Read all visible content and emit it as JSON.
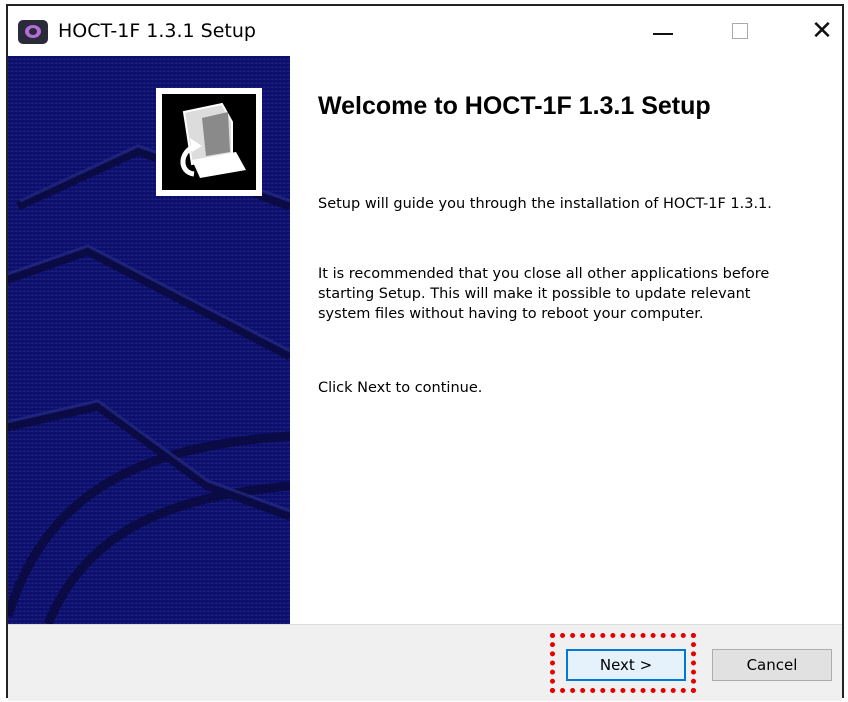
{
  "window": {
    "title": "HOCT-1F 1.3.1 Setup",
    "icon": "app-eye-icon"
  },
  "title_controls": {
    "minimize": "minimize-icon",
    "maximize": "maximize-icon",
    "close": "close-icon",
    "close_glyph": "✕"
  },
  "main": {
    "heading": "Welcome to HOCT-1F 1.3.1 Setup",
    "paragraph1": "Setup will guide you through the installation of HOCT-1F 1.3.1.",
    "paragraph2": "It is recommended that you close all other applications before starting Setup. This will make it possible to update relevant system files without having to reboot your computer.",
    "paragraph3": "Click Next to continue."
  },
  "footer": {
    "next_label": "Next >",
    "cancel_label": "Cancel"
  },
  "colors": {
    "sidebar": "#0d0f6e",
    "highlight": "#e60000",
    "focus": "#0078d7"
  }
}
